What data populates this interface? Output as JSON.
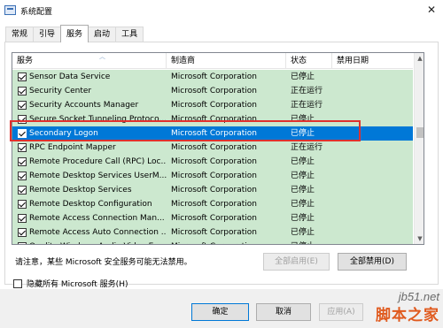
{
  "window": {
    "title": "系统配置",
    "close_glyph": "✕"
  },
  "tabs": [
    {
      "label": "常规"
    },
    {
      "label": "引导"
    },
    {
      "label": "服务"
    },
    {
      "label": "启动"
    },
    {
      "label": "工具"
    }
  ],
  "active_tab": "服务",
  "table": {
    "columns": [
      "服务",
      "制造商",
      "状态",
      "禁用日期"
    ],
    "rows": [
      {
        "name": "Sensor Data Service",
        "maker": "Microsoft Corporation",
        "status": "已停止",
        "checked": true
      },
      {
        "name": "Security Center",
        "maker": "Microsoft Corporation",
        "status": "正在运行",
        "checked": true
      },
      {
        "name": "Security Accounts Manager",
        "maker": "Microsoft Corporation",
        "status": "正在运行",
        "checked": true
      },
      {
        "name": "Secure Socket Tunneling Protoco...",
        "maker": "Microsoft Corporation",
        "status": "已停止",
        "checked": true
      },
      {
        "name": "Secondary Logon",
        "maker": "Microsoft Corporation",
        "status": "已停止",
        "checked": true,
        "selected": true
      },
      {
        "name": "RPC Endpoint Mapper",
        "maker": "Microsoft Corporation",
        "status": "正在运行",
        "checked": true
      },
      {
        "name": "Remote Procedure Call (RPC) Loc...",
        "maker": "Microsoft Corporation",
        "status": "已停止",
        "checked": true
      },
      {
        "name": "Remote Desktop Services UserM...",
        "maker": "Microsoft Corporation",
        "status": "已停止",
        "checked": true
      },
      {
        "name": "Remote Desktop Services",
        "maker": "Microsoft Corporation",
        "status": "已停止",
        "checked": true
      },
      {
        "name": "Remote Desktop Configuration",
        "maker": "Microsoft Corporation",
        "status": "已停止",
        "checked": true
      },
      {
        "name": "Remote Access Connection Man...",
        "maker": "Microsoft Corporation",
        "status": "已停止",
        "checked": true
      },
      {
        "name": "Remote Access Auto Connection ...",
        "maker": "Microsoft Corporation",
        "status": "已停止",
        "checked": true
      },
      {
        "name": "Quality Windows Audio Video Ex...",
        "maker": "Microsoft Corporation",
        "status": "已停止",
        "checked": true
      }
    ],
    "colors": {
      "row_bg": "#cce8cf",
      "selected_bg": "#0078d7",
      "highlight_border": "#e0312e"
    }
  },
  "note": "请注意，某些 Microsoft 安全服务可能无法禁用。",
  "buttons": {
    "enable_all": "全部启用(E)",
    "disable_all": "全部禁用(D)",
    "ok": "确定",
    "cancel": "取消",
    "apply": "应用(A)"
  },
  "hide_ms_label": "隐藏所有 Microsoft 服务(H)",
  "watermark": {
    "site": "jb51.net",
    "home": "脚本之家"
  }
}
